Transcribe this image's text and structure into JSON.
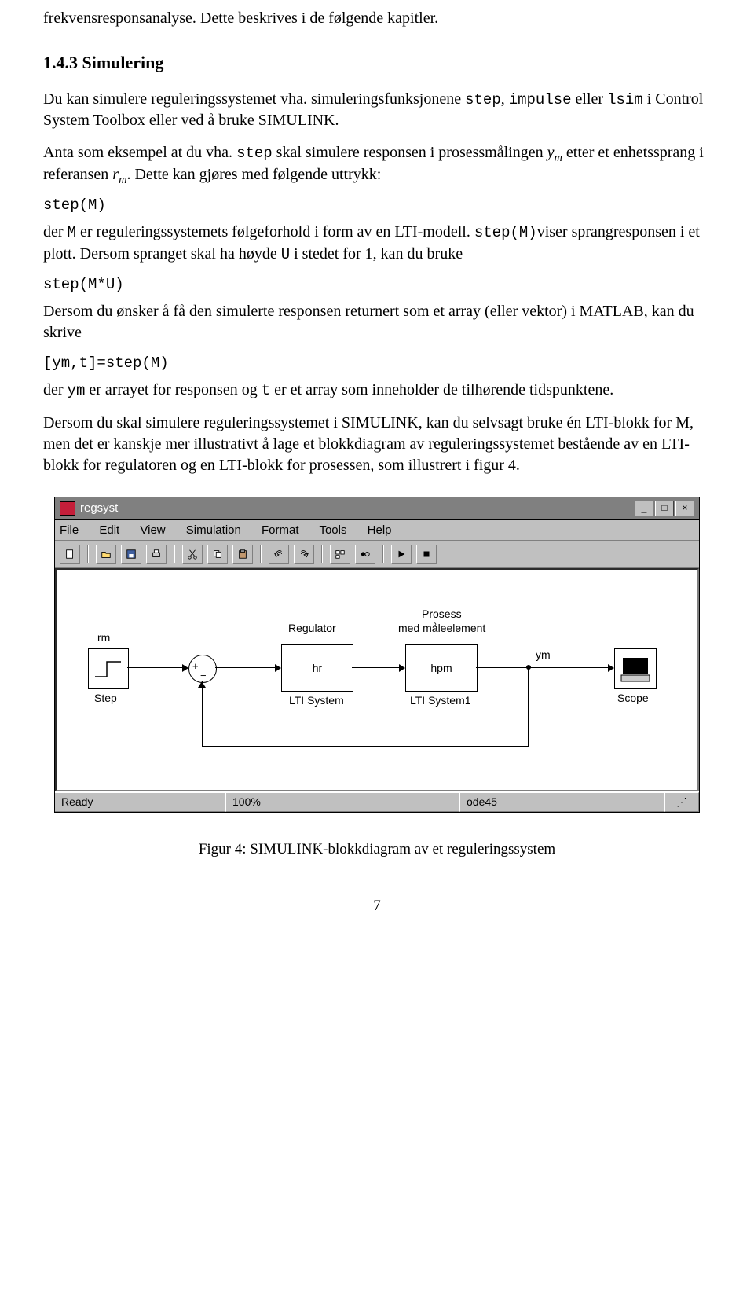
{
  "text": {
    "intro_tail": "frekvensresponsanalyse. Dette beskrives i de følgende kapitler.",
    "section": "1.4.3   Simulering",
    "p1a": "Du kan simulere reguleringssystemet vha. simuleringsfunksjonene ",
    "code_step": "step",
    "p1b": ", ",
    "code_impulse": "impulse",
    "p1c": " eller ",
    "code_lsim": "lsim",
    "p1d": " i Control System Toolbox eller ved å bruke SIMULINK.",
    "p2a": "Anta som eksempel at du vha. ",
    "p2b": " skal simulere responsen i prosessmålingen ",
    "ym": "y",
    "ym_sub": "m",
    "p2c": " etter et enhetssprang i referansen ",
    "rm": "r",
    "rm_sub": "m",
    "p2d": ". Dette kan gjøres med følgende uttrykk:",
    "code1": "step(M)",
    "p3a": "der ",
    "code_M": "M",
    "p3b": " er reguleringssystemets følgeforhold i form av en LTI-modell. ",
    "code_stepM2": "step(M)",
    "p3c": "viser sprangresponsen i et plott. Dersom spranget skal ha høyde ",
    "code_U": "U",
    "p3d": " i stedet for 1, kan du bruke",
    "code2": "step(M*U)",
    "p4": "Dersom du ønsker å få den simulerte responsen returnert som et array (eller vektor) i MATLAB, kan du skrive",
    "code3": "[ym,t]=step(M)",
    "p5a": "der ",
    "code_ym": "ym",
    "p5b": " er arrayet for responsen og ",
    "code_t": "t",
    "p5c": " er et array som inneholder de tilhørende tidspunktene.",
    "p6": "Dersom du skal simulere reguleringssystemet i SIMULINK, kan du selvsagt bruke én LTI-blokk for M, men det er kanskje mer illustrativt å lage et blokkdiagram av reguleringssystemet bestående av en LTI-blokk for regulatoren og en LTI-blokk for prosessen, som illustrert i figur 4.",
    "caption": "Figur 4: SIMULINK-blokkdiagram av et reguleringssystem",
    "pagenum": "7"
  },
  "simwin": {
    "title": "regsyst",
    "menus": [
      "File",
      "Edit",
      "View",
      "Simulation",
      "Format",
      "Tools",
      "Help"
    ],
    "status": {
      "left": "Ready",
      "zoom": "100%",
      "solver": "ode45"
    },
    "labels": {
      "rm": "rm",
      "step": "Step",
      "regulator": "Regulator",
      "hr": "hr",
      "lti1": "LTI System",
      "process_line1": "Prosess",
      "process_line2": "med måleelement",
      "hpm": "hpm",
      "lti2": "LTI System1",
      "ym": "ym",
      "scope": "Scope"
    }
  }
}
